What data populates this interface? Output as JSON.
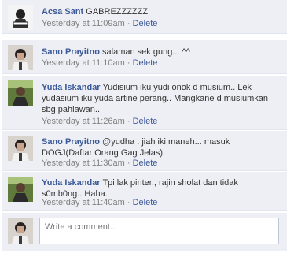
{
  "comments": [
    {
      "name": "Acsa Sant",
      "text": "GABREZZZZZZ",
      "time": "Yesterday at 11:09am",
      "dot": "·",
      "delete": "Delete"
    },
    {
      "name": "Sano Prayitno",
      "text": "salaman sek gung... ^^",
      "time": "Yesterday at 11:10am",
      "dot": "·",
      "delete": "Delete"
    },
    {
      "name": "Yuda Iskandar",
      "text": "Yudisium iku yudi onok d musium.. Lek yudasium iku yuda artine perang.. Mangkane d musiumkan sbg pahlawan..",
      "time": "Yesterday at 11:26am",
      "dot": "·",
      "delete": "Delete"
    },
    {
      "name": "Sano Prayitno",
      "text": "@yudha : jiah iki maneh... masuk DOGJ(Daftar Orang Gag Jelas)",
      "time": "Yesterday at 11:30am",
      "dot": "·",
      "delete": "Delete"
    },
    {
      "name": "Yuda Iskandar",
      "text": "Tpi lak pinter., rajin sholat dan tidak s0mb0ng.. Haha.",
      "time": "Yesterday at 11:40am",
      "dot": "·",
      "delete": "Delete"
    }
  ],
  "composer": {
    "placeholder": "Write a comment..."
  },
  "colors": {
    "link": "#3b5998",
    "background": "#edeff4",
    "meta": "#808080"
  }
}
